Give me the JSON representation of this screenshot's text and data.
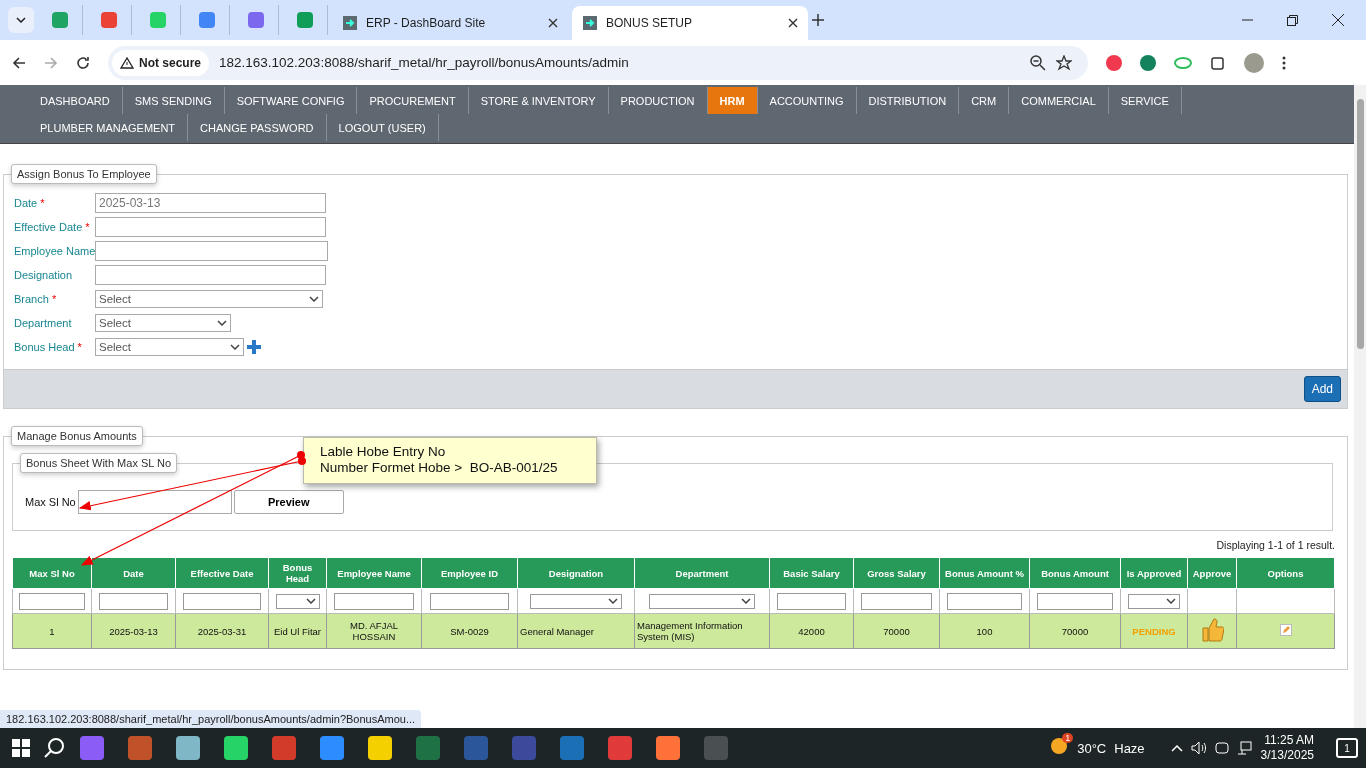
{
  "browser": {
    "tabs": [
      {
        "title": "ERP - DashBoard Site",
        "selected": false
      },
      {
        "title": "BONUS SETUP",
        "selected": true
      }
    ],
    "not_secure": "Not secure",
    "url": "182.163.102.203:8088/sharif_metal/hr_payroll/bonusAmounts/admin"
  },
  "nav": {
    "primary": [
      {
        "label": "DASHBOARD",
        "selected": false
      },
      {
        "label": "SMS SENDING",
        "selected": false
      },
      {
        "label": "SOFTWARE CONFIG",
        "selected": false
      },
      {
        "label": "PROCUREMENT",
        "selected": false
      },
      {
        "label": "STORE & INVENTORY",
        "selected": false
      },
      {
        "label": "PRODUCTION",
        "selected": false
      },
      {
        "label": "HRM",
        "selected": true
      },
      {
        "label": "ACCOUNTING",
        "selected": false
      },
      {
        "label": "DISTRIBUTION",
        "selected": false
      },
      {
        "label": "CRM",
        "selected": false
      },
      {
        "label": "COMMERCIAL",
        "selected": false
      },
      {
        "label": "SERVICE",
        "selected": false
      }
    ],
    "secondary": [
      {
        "label": "PLUMBER MANAGEMENT",
        "selected": false
      },
      {
        "label": "CHANGE PASSWORD",
        "selected": false
      },
      {
        "label": "LOGOUT (USER)",
        "selected": false
      }
    ]
  },
  "assign_form": {
    "legend": "Assign Bonus To Employee",
    "fields": [
      {
        "label": "Date",
        "required_mark": "*",
        "kind": "input",
        "value": "2025-03-13"
      },
      {
        "label": "Effective Date",
        "required_mark": "*",
        "kind": "input"
      },
      {
        "label": "Employee Name",
        "kind": "input"
      },
      {
        "label": "Designation",
        "kind": "input"
      },
      {
        "label": "Branch",
        "required_mark": "*",
        "kind": "select",
        "value": "Select"
      },
      {
        "label": "Department",
        "kind": "select",
        "value": "Select"
      },
      {
        "label": "Bonus Head",
        "required_mark": "*",
        "kind": "select",
        "value": "Select",
        "add_icon": true
      }
    ],
    "add_button": "Add"
  },
  "manage": {
    "legend": "Manage Bonus Amounts",
    "sheet": {
      "legend": "Bonus Sheet With Max SL No",
      "label": "Max Sl No",
      "button": "Preview"
    },
    "summary": "Displaying 1-1 of 1 result.",
    "table": {
      "columns": [
        {
          "label": "Max Sl No",
          "filter": {
            "kind": "input"
          }
        },
        {
          "label": "Date",
          "filter": {
            "kind": "input"
          }
        },
        {
          "label": "Effective Date",
          "filter": {
            "kind": "input"
          }
        },
        {
          "label": "Bonus Head",
          "filter": {
            "kind": "select"
          }
        },
        {
          "label": "Employee Name",
          "filter": {
            "kind": "input"
          }
        },
        {
          "label": "Employee ID",
          "filter": {
            "kind": "input"
          }
        },
        {
          "label": "Designation",
          "filter": {
            "kind": "select"
          }
        },
        {
          "label": "Department",
          "filter": {
            "kind": "select"
          }
        },
        {
          "label": "Basic Salary",
          "filter": {
            "kind": "input"
          }
        },
        {
          "label": "Gross Salary",
          "filter": {
            "kind": "input"
          }
        },
        {
          "label": "Bonus Amount %",
          "filter": {
            "kind": "input"
          }
        },
        {
          "label": "Bonus Amount",
          "filter": {
            "kind": "input"
          }
        },
        {
          "label": "Is Approved",
          "filter": {
            "kind": "select"
          }
        },
        {
          "label": "Approve"
        },
        {
          "label": "Options"
        }
      ],
      "rows": [
        {
          "cells": [
            "1",
            "2025-03-13",
            "2025-03-31",
            "Eid Ul Fitar",
            "MD. AFJAL HOSSAIN",
            "SM-0029",
            "General Manager",
            "Management Information System (MIS)",
            "42000",
            "70000",
            "100",
            "70000",
            "PENDING"
          ]
        }
      ]
    }
  },
  "annotation": {
    "lines": [
      "Lable Hobe Entry No",
      "Number Formet Hobe >  BO-AB-001/25"
    ]
  },
  "status_url": "182.163.102.203:8088/sharif_metal/hr_payroll/bonusAmounts/admin?BonusAmou...",
  "taskbar": {
    "weather_badge": "1",
    "temperature": "30°C",
    "condition": "Haze",
    "time": "11:25 AM",
    "date": "3/13/2025",
    "notifications": "1"
  }
}
